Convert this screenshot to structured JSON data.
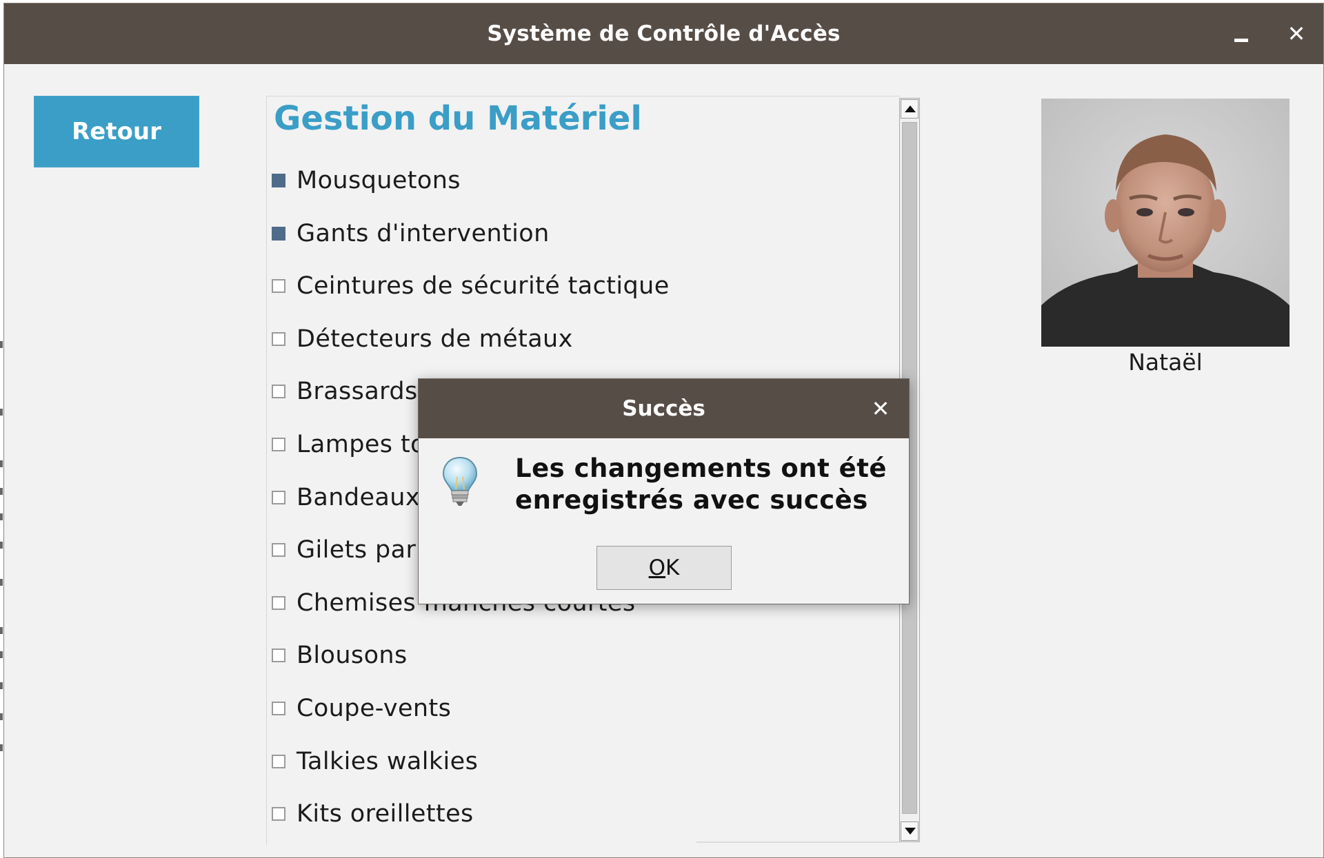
{
  "window": {
    "title": "Système de Contrôle d'Accès"
  },
  "toolbar": {
    "back_label": "Retour"
  },
  "panel": {
    "title": "Gestion du Matériel",
    "items": [
      {
        "label": "Mousquetons",
        "checked": true
      },
      {
        "label": "Gants d'intervention",
        "checked": true
      },
      {
        "label": "Ceintures de sécurité tactique",
        "checked": false
      },
      {
        "label": "Détecteurs de métaux",
        "checked": false
      },
      {
        "label": "Brassards",
        "checked": false
      },
      {
        "label": "Lampes to",
        "checked": false
      },
      {
        "label": "Bandeaux",
        "checked": false
      },
      {
        "label": "Gilets par",
        "checked": false
      },
      {
        "label": "Chemises manches courtes",
        "checked": false
      },
      {
        "label": "Blousons",
        "checked": false
      },
      {
        "label": "Coupe-vents",
        "checked": false
      },
      {
        "label": "Talkies walkies",
        "checked": false
      },
      {
        "label": "Kits oreillettes",
        "checked": false
      }
    ]
  },
  "profile": {
    "name": "Nataël"
  },
  "dialog": {
    "title": "Succès",
    "message": "Les changements ont été enregistrés avec succès",
    "ok_mnemonic": "O",
    "ok_rest": "K",
    "icon": "lightbulb-icon"
  },
  "colors": {
    "titlebar": "#574d47",
    "accent": "#3a9ec7",
    "checkbox_checked": "#4f6b8a"
  }
}
